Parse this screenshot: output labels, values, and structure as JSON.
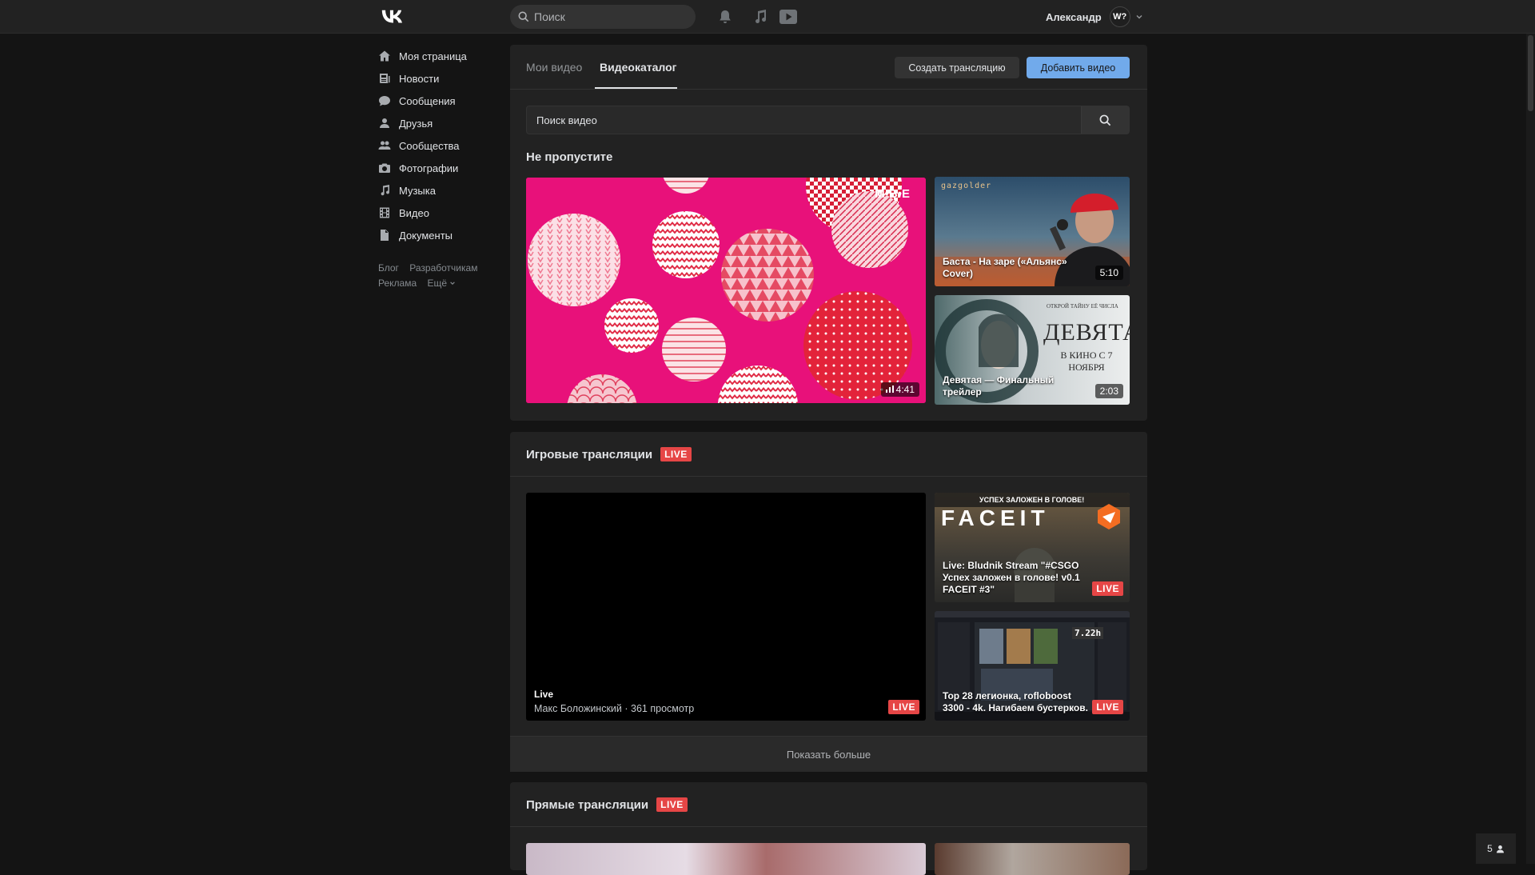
{
  "header": {
    "search_placeholder": "Поиск",
    "user_name": "Александр",
    "avatar_initials": "W?"
  },
  "sidebar": {
    "items": [
      {
        "label": "Моя страница",
        "icon": "home-icon"
      },
      {
        "label": "Новости",
        "icon": "news-icon"
      },
      {
        "label": "Сообщения",
        "icon": "messages-icon"
      },
      {
        "label": "Друзья",
        "icon": "friends-icon"
      },
      {
        "label": "Сообщества",
        "icon": "communities-icon"
      },
      {
        "label": "Фотографии",
        "icon": "camera-icon"
      },
      {
        "label": "Музыка",
        "icon": "music-icon"
      },
      {
        "label": "Видео",
        "icon": "video-icon"
      },
      {
        "label": "Документы",
        "icon": "document-icon"
      }
    ],
    "footer_links": [
      "Блог",
      "Разработчикам",
      "Реклама",
      "Ещё"
    ]
  },
  "tabs": [
    {
      "label": "Мои видео",
      "active": false
    },
    {
      "label": "Видеокаталог",
      "active": true
    }
  ],
  "actions": {
    "create_stream": "Создать трансляцию",
    "add_video": "Добавить видео"
  },
  "video_search": {
    "placeholder": "Поиск видео"
  },
  "sections": {
    "dont_miss": {
      "title": "Не пропустите",
      "main_video": {
        "duration": "4:41",
        "logo_text": "M•B•E"
      },
      "side_videos": [
        {
          "title": "Баста - На заре («Альянс» Cover)",
          "duration": "5:10",
          "overlay_text": "gazgolder"
        },
        {
          "title": "Девятая — Финальный трейлер",
          "duration": "2:03",
          "overlay_text": "ДЕВЯТАЯ",
          "overlay_sub": "В КИНО С 7 НОЯБРЯ",
          "overlay_top": "ОТКРОЙ ТАЙНУ ЕЁ ЧИСЛА"
        }
      ]
    },
    "game_streams": {
      "title": "Игровые трансляции",
      "badge": "LIVE",
      "main_stream": {
        "title": "Live",
        "author": "Макс Боложинский",
        "views": "361 просмотр",
        "badge": "LIVE"
      },
      "side_streams": [
        {
          "title": "Live: Bludnik Stream \"#CSGO Успех заложен в голове! v0.1 FACEIT #3\"",
          "badge": "LIVE",
          "overlay_text": "FACEIT",
          "overlay_top": "УСПЕХ ЗАЛОЖЕН В ГОЛОВЕ!"
        },
        {
          "title": "Top 28 легионка, rofloboost 3300 - 4k. Нагибаем бустерков.",
          "badge": "LIVE",
          "overlay_text": "7.22h"
        }
      ],
      "show_more": "Показать больше"
    },
    "live_streams": {
      "title": "Прямые трансляции",
      "badge": "LIVE"
    }
  },
  "online_count": "5",
  "colors": {
    "accent": "#71aaeb",
    "live": "#e64646",
    "background": "#141414",
    "card": "#222222"
  }
}
